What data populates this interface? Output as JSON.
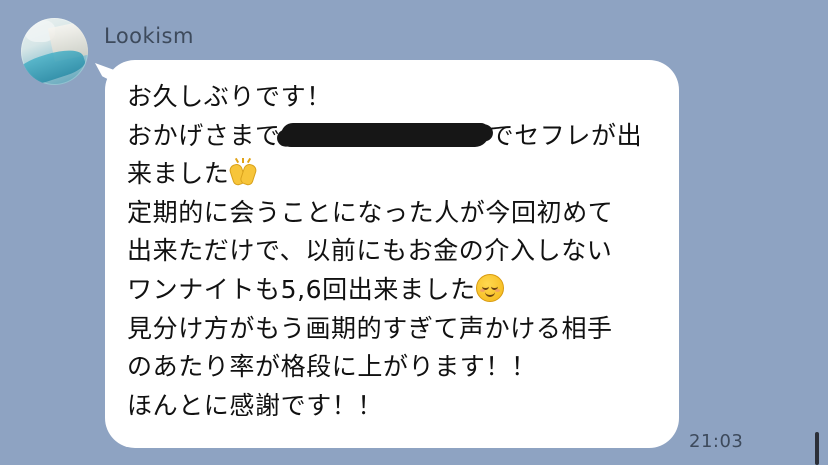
{
  "chat": {
    "sender_name": "Lookism",
    "timestamp": "21:03",
    "message": {
      "line1": "お久しぶりです！",
      "line2_prefix": "おかげさまで",
      "line2_suffix": "でセフレが出",
      "line3_text": "来ました",
      "line3_emoji": "raising-hands-emoji",
      "line4": "定期的に会うことになった人が今回初めて",
      "line5": "出来ただけで、以前にもお金の介入しない",
      "line6_text": "ワンナイトも5,6回出来ました",
      "line6_emoji": "smiling-face-emoji",
      "line7": "見分け方がもう画期的すぎて声かける相手",
      "line8": "のあたり率が格段に上がります！！",
      "line9": "ほんとに感謝です！！"
    }
  },
  "colors": {
    "background": "#8ea3c2",
    "bubble": "#ffffff",
    "text": "#111111",
    "meta_text": "#3d4a5c",
    "redaction": "#161616"
  }
}
